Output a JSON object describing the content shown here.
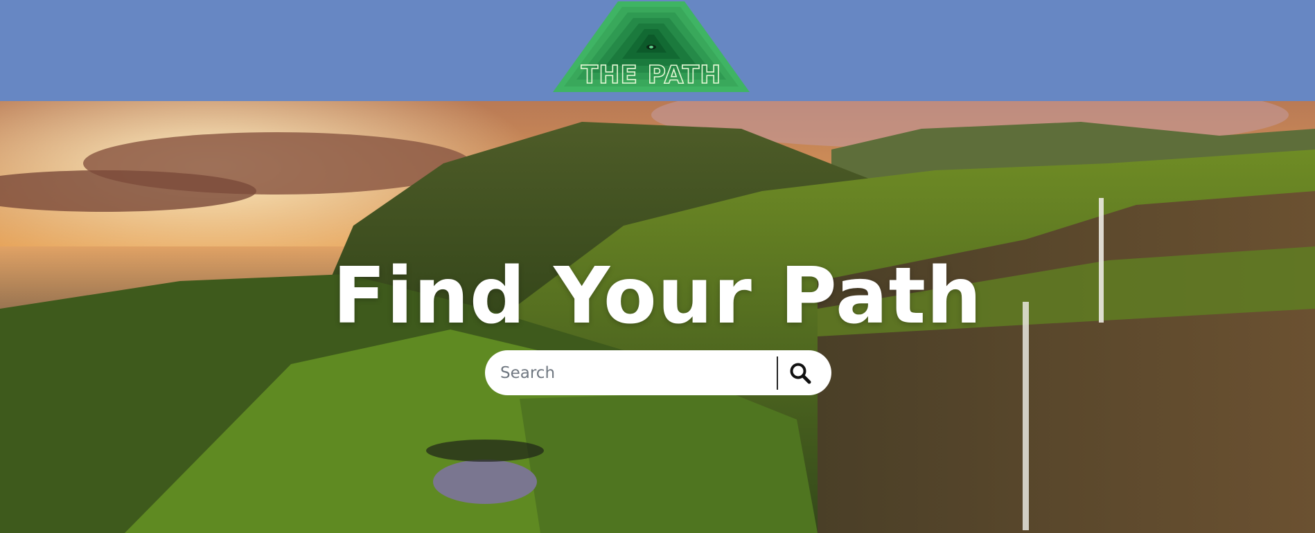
{
  "header": {
    "logo_text": "THE PATH",
    "background": "#6787c3",
    "logo_colors": {
      "outer": "#37a85a",
      "inner": "#0f5a2e",
      "text": "#d9f5c8"
    }
  },
  "hero": {
    "title": "Find Your Path",
    "search": {
      "placeholder": "Search",
      "value": "",
      "button_icon": "search-icon"
    }
  }
}
